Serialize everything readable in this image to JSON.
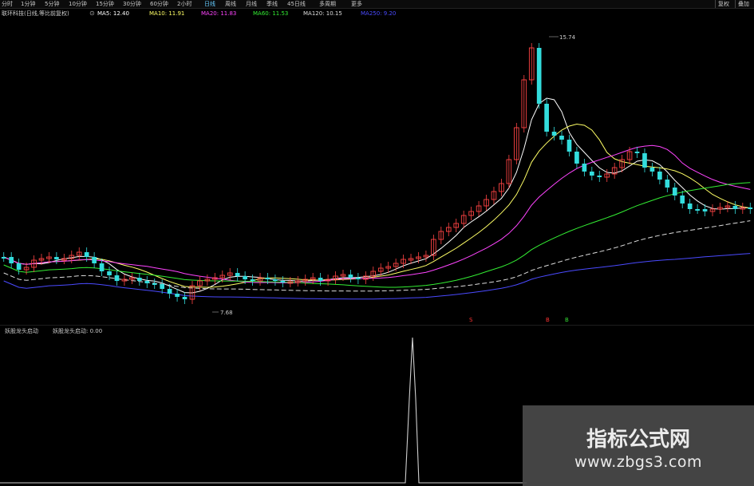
{
  "toolbar": {
    "timeframes": [
      "分时",
      "1分钟",
      "5分钟",
      "10分钟",
      "15分钟",
      "30分钟",
      "60分钟",
      "2小时",
      "日线",
      "周线",
      "月线",
      "季线",
      "45日线",
      "多周期"
    ],
    "active_timeframe": "日线",
    "more_label": "更多",
    "right_buttons": [
      "复权",
      "叠加"
    ]
  },
  "legend": {
    "stock": "联环科技(日线,等比前复权)",
    "indicators": [
      {
        "label": "MA5: 12.40",
        "color": "#ffffff"
      },
      {
        "label": "MA10: 11.91",
        "color": "#ffff66"
      },
      {
        "label": "MA20: 11.83",
        "color": "#ff44ff"
      },
      {
        "label": "MA60: 11.53",
        "color": "#33ee33"
      },
      {
        "label": "MA120: 10.15",
        "color": "#dddddd"
      },
      {
        "label": "MA250: 9.20",
        "color": "#4a4aff"
      }
    ]
  },
  "sub_legend": {
    "title": "妖股龙头启动",
    "field": "妖股龙头启动: 0.00"
  },
  "annotations": {
    "high": "15.74",
    "low": "7.68"
  },
  "markers": [
    "S",
    "B",
    "B"
  ],
  "watermark": {
    "title": "指标公式网",
    "url": "www.zbgs3.com"
  },
  "colors": {
    "up": "#ff4444",
    "down": "#33dddd",
    "background": "#000000"
  }
}
